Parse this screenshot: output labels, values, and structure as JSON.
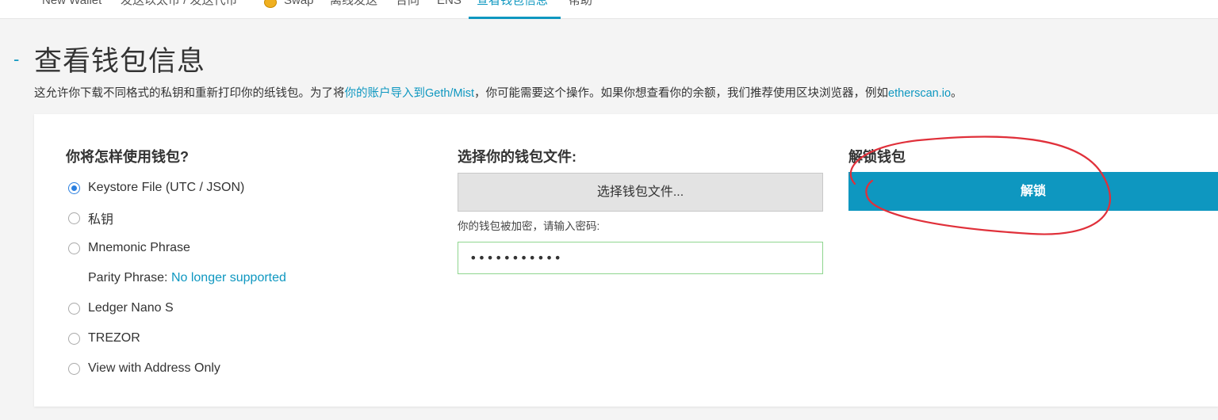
{
  "nav": {
    "items": [
      {
        "label": "New Wallet"
      },
      {
        "label": "发送以太币 / 发送代币"
      },
      {
        "label": "Swap"
      },
      {
        "label": "离线发送"
      },
      {
        "label": "合同"
      },
      {
        "label": "ENS"
      },
      {
        "label": "查看钱包信息"
      },
      {
        "label": "帮助"
      }
    ],
    "active_index": 6
  },
  "page": {
    "collapse_symbol": "-",
    "title": "查看钱包信息",
    "desc_part1": "这允许你下载不同格式的私钥和重新打印你的纸钱包。为了将",
    "desc_link1": "你的账户导入到Geth/Mist",
    "desc_part2": "，你可能需要这个操作。如果你想查看你的余额，我们推荐使用区块浏览器，例如",
    "desc_link2": "etherscan.io",
    "desc_part3": "。"
  },
  "access": {
    "heading": "你将怎样使用钱包?",
    "options": [
      {
        "label": "Keystore File (UTC / JSON)",
        "selected": true
      },
      {
        "label": "私钥",
        "selected": false
      },
      {
        "label": "Mnemonic Phrase",
        "selected": false
      },
      {
        "label": "Ledger Nano S",
        "selected": false
      },
      {
        "label": "TREZOR",
        "selected": false
      },
      {
        "label": "View with Address Only",
        "selected": false
      }
    ],
    "parity_label": "Parity Phrase: ",
    "parity_link": "No longer supported"
  },
  "file": {
    "heading": "选择你的钱包文件:",
    "button_label": "选择钱包文件...",
    "password_label": "你的钱包被加密，请输入密码:",
    "password_value": "•••••••••••"
  },
  "unlock": {
    "heading": "解锁钱包",
    "button_label": "解锁"
  },
  "colors": {
    "accent": "#0e97c0",
    "radio_selected": "#2a7fe0",
    "annotation": "#e0303a",
    "input_focus_border": "#8fd68f"
  }
}
